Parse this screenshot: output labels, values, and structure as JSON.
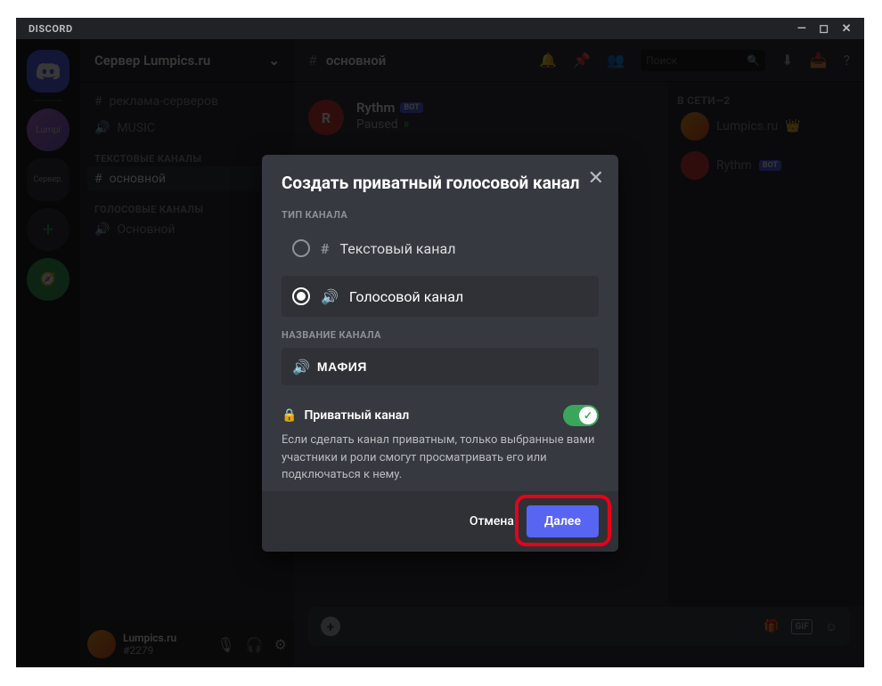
{
  "app": {
    "title": "DISCORD"
  },
  "server": {
    "name": "Сервер Lumpics.ru",
    "rail_labels": {
      "grad": "Lumpi",
      "text": "Сервер."
    }
  },
  "sidebar": {
    "items": [
      {
        "icon": "hash",
        "label": "реклама-серверов"
      },
      {
        "icon": "speaker",
        "label": "MUSIC"
      }
    ],
    "cats": [
      {
        "label": "ТЕКСТОВЫЕ КАНАЛЫ"
      },
      {
        "label": "ГОЛОСОВЫЕ КАНАЛЫ"
      }
    ],
    "text_channel": "основной",
    "voice_channel": "Основной"
  },
  "header": {
    "channel": "основной",
    "search_placeholder": "Поиск"
  },
  "chat": {
    "bot_name": "Rythm",
    "bot_tag": "BOT",
    "status_label": "Paused"
  },
  "members": {
    "cat": "В СЕТИ—2",
    "list": [
      {
        "name": "Lumpics.ru",
        "badge": "👑",
        "avatar": "grad"
      },
      {
        "name": "Rythm",
        "badge": "BOT",
        "avatar": "red"
      }
    ]
  },
  "user": {
    "name": "Lumpics.ru",
    "tag": "#2279"
  },
  "modal": {
    "title": "Создать приватный голосовой канал",
    "type_label": "ТИП КАНАЛА",
    "type_text": "Текстовый канал",
    "type_voice": "Голосовой канал",
    "name_label": "НАЗВАНИЕ КАНАЛА",
    "name_value": "МАФИЯ",
    "private_label": "Приватный канал",
    "private_desc": "Если сделать канал приватным, только выбранные вами участники и роли смогут просматривать его или подключаться к нему.",
    "cancel": "Отмена",
    "next": "Далее"
  }
}
